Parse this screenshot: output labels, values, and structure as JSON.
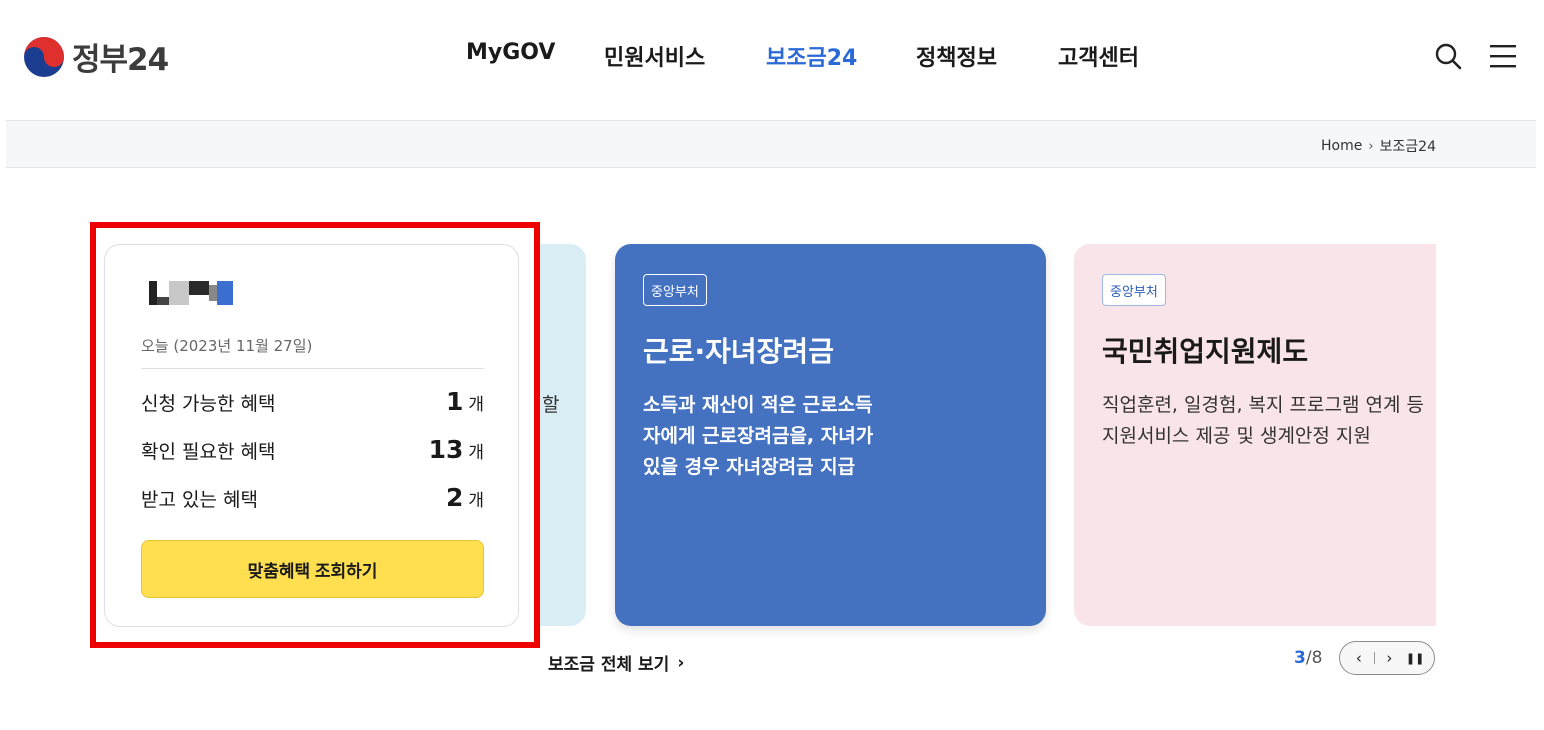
{
  "header": {
    "logo_text": "정부24",
    "nav": [
      {
        "label": "MyGOV",
        "active": false
      },
      {
        "label": "민원서비스",
        "active": false
      },
      {
        "label": "보조금24",
        "active": true
      },
      {
        "label": "정책정보",
        "active": false
      },
      {
        "label": "고객센터",
        "active": false
      }
    ]
  },
  "breadcrumb": {
    "home": "Home",
    "separator": "›",
    "current": "보조금24"
  },
  "user_card": {
    "date_line": "오늘 (2023년 11월 27일)",
    "stats": [
      {
        "label": "신청 가능한 혜택",
        "value": "1",
        "unit": "개"
      },
      {
        "label": "확인 필요한 혜택",
        "value": "13",
        "unit": "개"
      },
      {
        "label": "받고 있는 혜택",
        "value": "2",
        "unit": "개"
      }
    ],
    "cta_label": "맞춤혜택 조회하기"
  },
  "carousel": {
    "peek_text": "할",
    "slides": [
      {
        "badge": "중앙부처",
        "title": "근로·자녀장려금",
        "desc": "소득과 재산이 적은 근로소득자에게 근로장려금을, 자녀가 있을 경우 자녀장려금 지급"
      },
      {
        "badge": "중앙부처",
        "title": "국민취업지원제도",
        "desc": "직업훈련, 일경험, 복지 프로그램 연계 등 지원서비스 제공 및 생계안정 지원"
      }
    ],
    "view_all": "보조금 전체 보기",
    "view_all_arrow": "›",
    "page_current": "3",
    "page_sep": "/",
    "page_total": "8",
    "prev_glyph": "‹",
    "next_glyph": "›",
    "pause_glyph": "❚❚"
  },
  "colors": {
    "accent": "#2a6ad8",
    "cta": "#ffdf50",
    "slide_blue": "#4472c0",
    "slide_pink": "#f9e4e9",
    "highlight_frame": "#ee0000"
  }
}
